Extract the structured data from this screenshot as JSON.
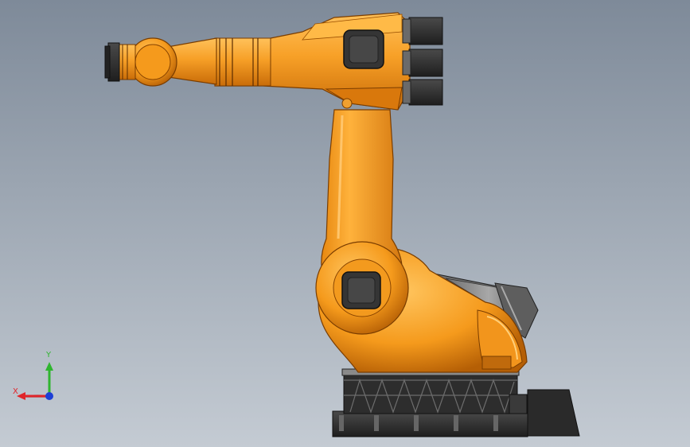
{
  "viewport": {
    "background_top": "#7e8a99",
    "background_bottom": "#c4cbd3"
  },
  "model": {
    "name": "industrial-robot-arm",
    "body_color": "#f39a1e",
    "body_shadow_color": "#c86a08",
    "dark_color": "#2c2c2c",
    "gray_color": "#7c7c7c"
  },
  "triad": {
    "x_label": "X",
    "y_label": "Y",
    "x_color": "#e0252a",
    "y_color": "#2fb52f",
    "z_color": "#1d3fd6"
  }
}
